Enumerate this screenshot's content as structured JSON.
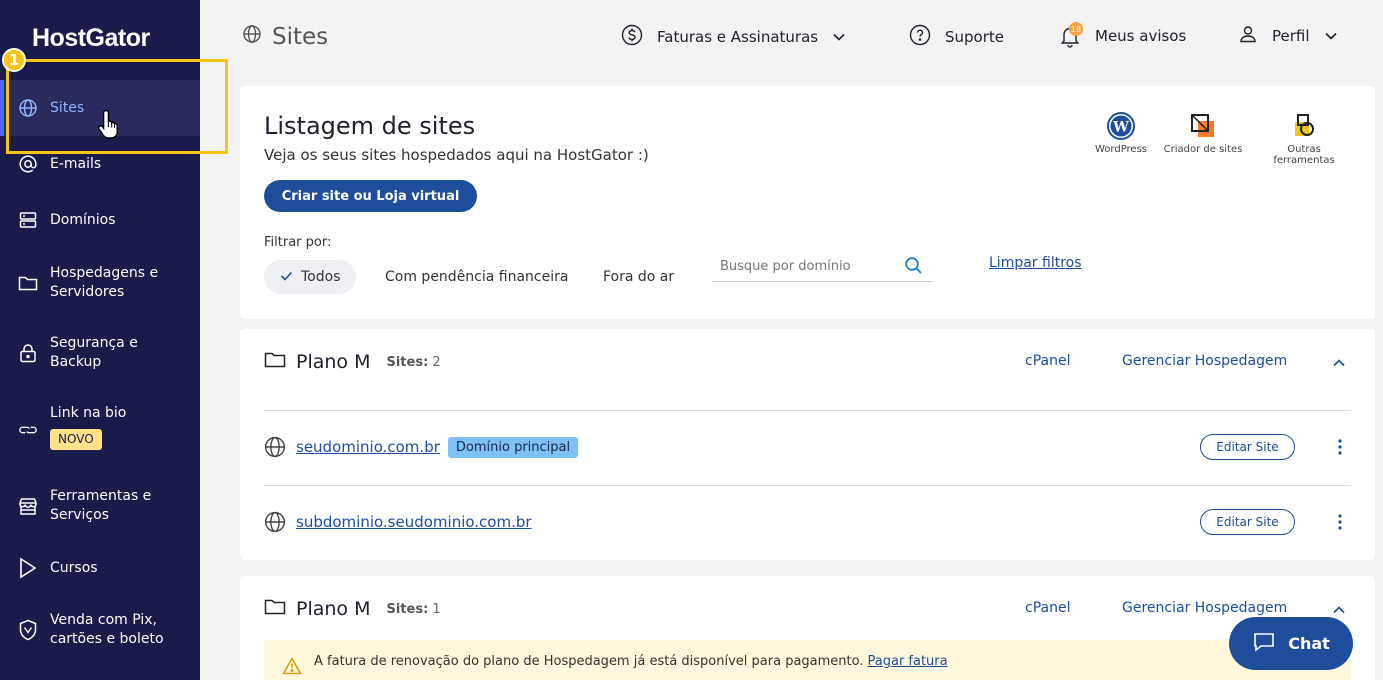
{
  "brand": {
    "logo": "HostGator"
  },
  "step_badge": "1",
  "sidebar": {
    "items": [
      {
        "label": "Sites",
        "icon": "globe-icon",
        "active": true
      },
      {
        "label": "E-mails",
        "icon": "at-icon"
      },
      {
        "label": "Domínios",
        "icon": "server-icon"
      },
      {
        "label": "Hospedagens e Servidores",
        "icon": "folder-icon"
      },
      {
        "label": "Segurança e Backup",
        "icon": "lock-icon"
      },
      {
        "label": "Link na bio",
        "icon": "link-icon",
        "badge": "NOVO"
      },
      {
        "label": "Ferramentas e Serviços",
        "icon": "store-icon"
      },
      {
        "label": "Cursos",
        "icon": "play-icon"
      },
      {
        "label": "Venda com Pix, cartões e boleto",
        "icon": "shield-icon"
      }
    ]
  },
  "header": {
    "title": "Sites",
    "nav": {
      "billing": "Faturas e Assinaturas",
      "support": "Suporte",
      "notices": "Meus avisos",
      "notices_count": "18",
      "profile": "Perfil"
    }
  },
  "listing": {
    "title": "Listagem de sites",
    "subtitle": "Veja os seus sites hospedados aqui na HostGator :)",
    "create_button": "Criar site ou Loja virtual",
    "tools": [
      "WordPress",
      "Criador de sites",
      "Outras ferramentas"
    ],
    "filter_label": "Filtrar por:",
    "filters": [
      "Todos",
      "Com pendência financeira",
      "Fora do ar"
    ],
    "search_placeholder": "Busque por domínio",
    "clear_filters": "Limpar filtros"
  },
  "plans": [
    {
      "name": "Plano M",
      "sites_label": "Sites:",
      "sites_count": "2",
      "cpanel": "cPanel",
      "manage": "Gerenciar Hospedagem",
      "sites": [
        {
          "domain": "seudominio.com.br",
          "tag": "Domínio principal",
          "edit": "Editar Site"
        },
        {
          "domain": "subdominio.seudominio.com.br",
          "edit": "Editar Site"
        }
      ]
    },
    {
      "name": "Plano M",
      "sites_label": "Sites:",
      "sites_count": "1",
      "cpanel": "cPanel",
      "manage": "Gerenciar Hospedagem",
      "warning": "A fatura de renovação do plano de Hospedagem já está disponível para pagamento.",
      "warning_link": "Pagar fatura"
    }
  ],
  "chat": {
    "label": "Chat"
  },
  "colors": {
    "sidebar_bg": "#1a1a4b",
    "primary": "#1e4d9b",
    "highlight": "#f5c518",
    "tag_bg": "#7ec1f7"
  }
}
